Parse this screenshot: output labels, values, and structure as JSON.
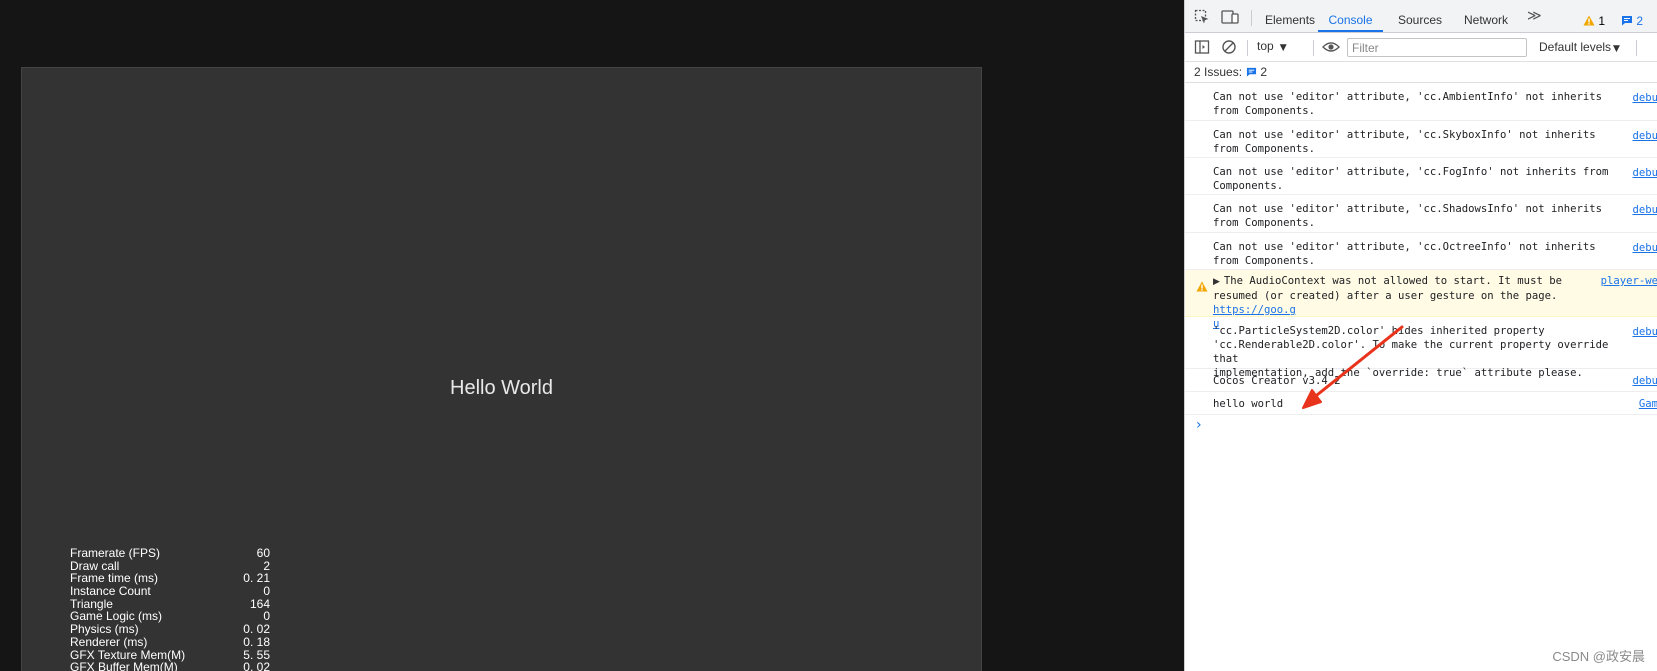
{
  "game": {
    "label": "Hello World",
    "stats": [
      {
        "name": "Framerate (FPS)",
        "value": "60"
      },
      {
        "name": "Draw call",
        "value": "2"
      },
      {
        "name": "Frame time (ms)",
        "value": "0. 21"
      },
      {
        "name": "Instance Count",
        "value": "0"
      },
      {
        "name": "Triangle",
        "value": "164"
      },
      {
        "name": "Game Logic (ms)",
        "value": "0"
      },
      {
        "name": "Physics (ms)",
        "value": "0. 02"
      },
      {
        "name": "Renderer (ms)",
        "value": "0. 18"
      },
      {
        "name": "GFX Texture Mem(M)",
        "value": "5. 55"
      },
      {
        "name": "GFX Buffer Mem(M)",
        "value": "0. 02"
      }
    ]
  },
  "devtools": {
    "tabs": [
      {
        "id": "elements",
        "label": "Elements"
      },
      {
        "id": "console",
        "label": "Console"
      },
      {
        "id": "sources",
        "label": "Sources"
      },
      {
        "id": "network",
        "label": "Network"
      }
    ],
    "active_tab": "console",
    "more_tabs_glyph": "≫",
    "warnings_count": "1",
    "issues_count": "2",
    "toolbar": {
      "context": "top",
      "filter_placeholder": "Filter",
      "levels": "Default levels"
    },
    "issues_bar": {
      "label": "2 Issues:",
      "count": "2"
    },
    "messages": [
      {
        "text": "Can not use 'editor' attribute, 'cc.AmbientInfo' not inherits\nfrom Components.",
        "source": "debu"
      },
      {
        "text": "Can not use 'editor' attribute, 'cc.SkyboxInfo' not inherits\nfrom Components.",
        "source": "debu"
      },
      {
        "text": "Can not use 'editor' attribute, 'cc.FogInfo' not inherits from\nComponents.",
        "source": "debu"
      },
      {
        "text": "Can not use 'editor' attribute, 'cc.ShadowsInfo' not inherits\nfrom Components.",
        "source": "debu"
      },
      {
        "text": "Can not use 'editor' attribute, 'cc.OctreeInfo' not inherits\nfrom Components.",
        "source": "debu"
      }
    ],
    "warning": {
      "text": "The AudioContext was not allowed to start. It must be\nresumed (or created) after a user gesture on the page. ",
      "link": "https://goo.g",
      "link_cont": "u",
      "source": "player-we"
    },
    "messages2": [
      {
        "text": "'cc.ParticleSystem2D.color' hides inherited property\n'cc.Renderable2D.color'. To make the current property override that\nimplementation, add the `override: true` attribute please.",
        "source": "debu"
      },
      {
        "text": "Cocos Creator v3.4.2",
        "source": "debu"
      },
      {
        "text": "hello world",
        "source": "Gam"
      }
    ],
    "prompt": "›"
  },
  "watermark": "CSDN @政安晨",
  "colors": {
    "accent": "#1a73e8",
    "warning_bg": "#fffbe5",
    "warning_icon": "#f2a600",
    "annotation_arrow": "#e8341c",
    "canvas_bg": "#333333"
  }
}
